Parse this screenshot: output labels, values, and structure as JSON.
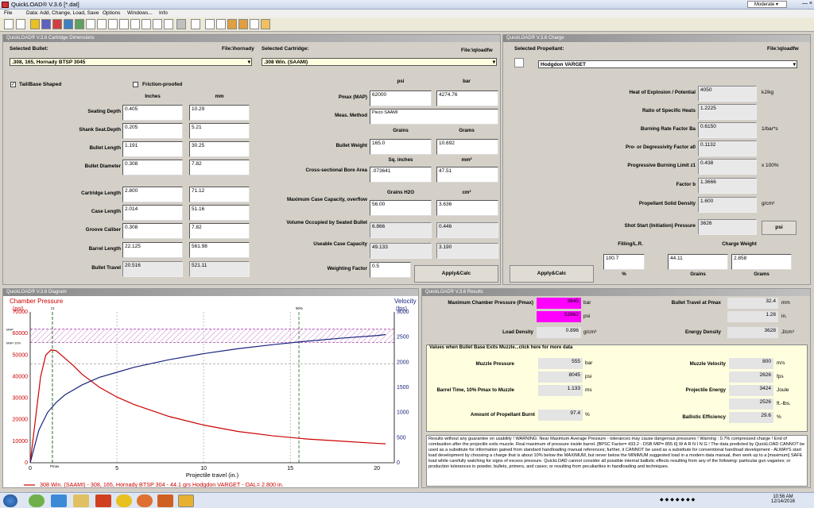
{
  "app": {
    "title": "QuickLOAD® V.3.6  [*.dat]",
    "profile": "Moderate"
  },
  "menu": [
    "File",
    "Data: Add, Change, Load, Save",
    "Options",
    "Windows...",
    "Info"
  ],
  "cart": {
    "header": "QuickLOAD® V.3.6 Cartridge Dimensions",
    "sel_bullet_label": "Selected Bullet:",
    "file_b": "File:\\hornady",
    "bullet": ".308, 165, Hornady BTSP 3045",
    "sel_cart_label": "Selected Cartridge:",
    "file_c": "File:\\qloadfw",
    "cartridge": ".308 Win. (SAAMI)",
    "tail": "Tail/Base Shaped",
    "friction": "Friction-proofed",
    "inches": "Inches",
    "mm": "mm",
    "rows": [
      {
        "label": "Seating Depth",
        "in": "0.405",
        "mm": "10.29"
      },
      {
        "label": "Shank Seat.Depth",
        "in": "0.205",
        "mm": "5.21"
      },
      {
        "label": "Bullet Length",
        "in": "1.191",
        "mm": "30.25"
      },
      {
        "label": "Bullet Diameter",
        "in": "0.308",
        "mm": "7.82"
      },
      {
        "label": "Cartridge Length",
        "in": "2.800",
        "mm": "71.12"
      },
      {
        "label": "Case Length",
        "in": "2.014",
        "mm": "51.16"
      },
      {
        "label": "Groove Caliber",
        "in": "0.308",
        "mm": "7.82"
      },
      {
        "label": "Barrel Length",
        "in": "22.125",
        "mm": "561.98"
      },
      {
        "label": "Bullet Travel",
        "in": "20.516",
        "mm": "521.11"
      }
    ],
    "psi": "psi",
    "bar": "bar",
    "pmax_label": "Pmax (MAP)",
    "pmax_psi": "62000",
    "pmax_bar": "4274.76",
    "meas_label": "Meas. Method",
    "meas": "Piezo SAAMI",
    "grains": "Grains",
    "grams": "Grams",
    "bw_label": "Bullet Weight",
    "bw_gr": "165.0",
    "bw_g": "10.692",
    "sqin": "Sq. inches",
    "mm2": "mm²",
    "bore_label": "Cross-sectional Bore Area",
    "bore_in": ".073641",
    "bore_mm": "47.51",
    "grh2o": "Grains H2O",
    "cm3": "cm³",
    "maxcap_label": "Maximum Case Capacity, overflow",
    "maxcap_gr": "56.00",
    "maxcap_cm": "3.636",
    "volseat_label": "Volume Occupied by Seated Bullet",
    "volseat_gr": "6.866",
    "volseat_cm": "0.446",
    "usable_label": "Useable Case Capacity",
    "usable_gr": "49.133",
    "usable_cm": "3.190",
    "wf_label": "Weighting Factor",
    "wf": "0.5",
    "apply": "Apply&Calc"
  },
  "charge": {
    "header": "QuickLOAD® V.3.6 Charge",
    "sel_label": "Selected Propellant:",
    "file": "File:\\qloadfw",
    "propellant": "Hodgdon VARGET",
    "rows": [
      {
        "label": "Heat of Explosion / Potential",
        "val": "4050",
        "unit": "kJ/kg"
      },
      {
        "label": "Ratio of Specific Heats",
        "val": "1.2225",
        "unit": ""
      },
      {
        "label": "Burning Rate Factor  Ba",
        "val": "0.6150",
        "unit": "1/bar*s"
      },
      {
        "label": "Pro- or Degressivity Factor  a0",
        "val": "0.1132",
        "unit": ""
      },
      {
        "label": "Progressive Burning Limit z1",
        "val": "0.438",
        "unit": "x 100%"
      },
      {
        "label": "Factor  b",
        "val": "1.3666",
        "unit": ""
      },
      {
        "label": "Propellant Solid Density",
        "val": "1.600",
        "unit": "g/cm³"
      },
      {
        "label": "Shot Start (Initiation) Pressure",
        "val": "3626",
        "unit": ""
      }
    ],
    "psi_btn": "psi",
    "filling_label": "Filling/L.R.",
    "cw_label": "Charge Weight",
    "filling": "100.7",
    "pct": "%",
    "cw_gr": "44.11",
    "cw_g": "2.858",
    "grains": "Grains",
    "grams": "Grams",
    "apply": "Apply&Calc"
  },
  "diagram": {
    "header": "QuickLOAD® V.3.6 Diagram",
    "legend": "308 Win. (SAAMI) - 308, 165, Hornady BTSP 304 - 44.1 grs Hodgdon VARGET - OAL= 2.800 in."
  },
  "chart_data": {
    "type": "line",
    "title": "",
    "xlabel": "Projectile travel (in.)",
    "ylabel": "Chamber Pressure (psi)",
    "y2label": "Velocity (fps)",
    "xlim": [
      0,
      21
    ],
    "ylim": [
      0,
      70000
    ],
    "y2lim": [
      0,
      3000
    ],
    "xticks": [
      "0",
      "5",
      "10",
      "15",
      "20"
    ],
    "yticks": [
      "0",
      "10000",
      "20000",
      "30000",
      "40000",
      "50000",
      "60000",
      "70000"
    ],
    "y2ticks": [
      "0",
      "500",
      "1000",
      "1500",
      "2000",
      "2500",
      "3000"
    ],
    "markers": [
      "Pmax",
      "z1",
      "90%",
      "MAP-10%",
      "MAP"
    ],
    "series": [
      {
        "name": "Chamber Pressure",
        "color": "#cc0000",
        "x": [
          0,
          0.3,
          0.6,
          0.9,
          1.2,
          1.5,
          2,
          2.5,
          3,
          4,
          5,
          6,
          8,
          10,
          12,
          14,
          16,
          18,
          20,
          20.5
        ],
        "y": [
          0,
          20000,
          40000,
          50000,
          52400,
          52000,
          48500,
          45000,
          41000,
          35000,
          30500,
          27000,
          21500,
          17500,
          14500,
          12500,
          11000,
          10000,
          9000,
          8800
        ]
      },
      {
        "name": "Velocity",
        "color": "#1a237e",
        "axis": "y2",
        "x": [
          0,
          0.5,
          1,
          1.5,
          2,
          3,
          4,
          5,
          6,
          8,
          10,
          12,
          14,
          16,
          18,
          20,
          20.5
        ],
        "y": [
          0,
          650,
          1000,
          1200,
          1350,
          1550,
          1700,
          1800,
          1900,
          2050,
          2170,
          2270,
          2350,
          2420,
          2480,
          2530,
          2550
        ]
      }
    ]
  },
  "results": {
    "header": "QuickLOAD® V.3.6 Results",
    "mcp_label": "Maximum Chamber Pressure (Pmax)",
    "mcp_bar": "3645",
    "mcp_psi": "52862",
    "bar": "bar",
    "psi": "psi",
    "bt_label": "Bullet Travel at Pmax",
    "bt_mm": "32.4",
    "bt_in": "1.28",
    "mm": "mm",
    "in": "in.",
    "ld_label": "Load Density",
    "ld": "0.896",
    "gcm3": "g/cm³",
    "ed_label": "Energy Density",
    "ed": "3628",
    "jcm3": "J/cm³",
    "muzzle_head": "Values when Bullet Base Exits Muzzle...click here for more data",
    "mp_label": "Muzzle Pressure",
    "mp_bar": "555",
    "mp_psi": "8045",
    "mv_label": "Muzzle Velocity",
    "mv_ms": "800",
    "mv_fps": "2626",
    "ms": "m/s",
    "fps": "fps",
    "btm_label": "Barrel Time, 10% Pmax to Muzzle",
    "btm": "1.133",
    "msu": "ms",
    "pe_label": "Projectile Energy",
    "pe_j": "3424",
    "pe_ft": "2526",
    "joule": "Joule",
    "ftlbs": "ft.-lbs.",
    "apb_label": "Amount of Propellant Burnt",
    "apb": "97.4",
    "be_label": "Ballistic Efficiency",
    "be": "29.6",
    "pct": "%",
    "warning": "Results without any guarantee on usability !  WARNING: Near Maximum Average Pressure - tolerances may cause dangerous pressures !  Warning : 0.7% compressed charge !  End of combustion after the projectile exits muzzle.  Real maximum of pressure inside barrel.  [BPSC Factor= 433.2 - DSB MIP= 855.6]                W A R N I N G !                The data predicted by QuickLOAD CANNOT be used as a substitute for information gained from standard handloading manual references; further, it CANNOT be used as a substitute for conventional handload development - ALWAYS start load development by choosing a charge that is about 10% below the MAXIMUM, but never below the MINIMUM suggested load in a modern data manual, then work up to a [maximum] SAFE load while carefully watching for signs of excess pressure. QuickLOAD cannot consider all possible internal ballistic effects resulting from any of the following: particular gun vagaries; or production tolerances in powder, bullets, primers, and cases; or resulting from peculiarities in handloading and techniques."
  },
  "tray": {
    "time": "10:56 AM",
    "date": "12/14/2016"
  },
  "colors": {
    "magenta": "#ff00ff",
    "panel": "#d4d0c8",
    "pressure": "#cc0000",
    "velocity": "#1a237e"
  }
}
